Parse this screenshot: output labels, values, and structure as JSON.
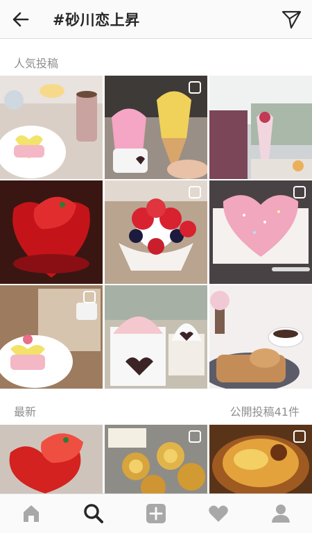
{
  "header": {
    "title": "#砂川恋上昇",
    "back_icon": "arrow-left-icon",
    "share_icon": "paper-plane-icon"
  },
  "sections": {
    "top_label": "人気投稿",
    "recent_label": "最新",
    "post_count": "公開投稿41件"
  },
  "photos": {
    "top": [
      {
        "subject": "heart cake with pink drink",
        "multi": false
      },
      {
        "subject": "pink and yellow soft serve",
        "multi": true
      },
      {
        "subject": "parfait at window",
        "multi": false
      },
      {
        "subject": "red heart jelly with strawberry",
        "multi": false
      },
      {
        "subject": "strawberry blueberry parfait",
        "multi": true
      },
      {
        "subject": "pink heart cake",
        "multi": true
      },
      {
        "subject": "heart cake on plate",
        "multi": true
      },
      {
        "subject": "soft serve with chocolate heart",
        "multi": false
      },
      {
        "subject": "pastries and coffee",
        "multi": false
      }
    ],
    "recent": [
      {
        "subject": "red heart jelly",
        "multi": false
      },
      {
        "subject": "egg tarts on tray",
        "multi": true
      },
      {
        "subject": "egg tart closeup",
        "multi": true
      }
    ]
  },
  "tabbar": {
    "items": [
      "home-icon",
      "search-icon",
      "add-post-icon",
      "heart-icon",
      "profile-icon"
    ],
    "active": "search-icon"
  },
  "colors": {
    "bar_bg": "#fafafa",
    "divider": "#dbdbdb",
    "label_gray": "#8e8e8e",
    "text_dark": "#262626"
  }
}
